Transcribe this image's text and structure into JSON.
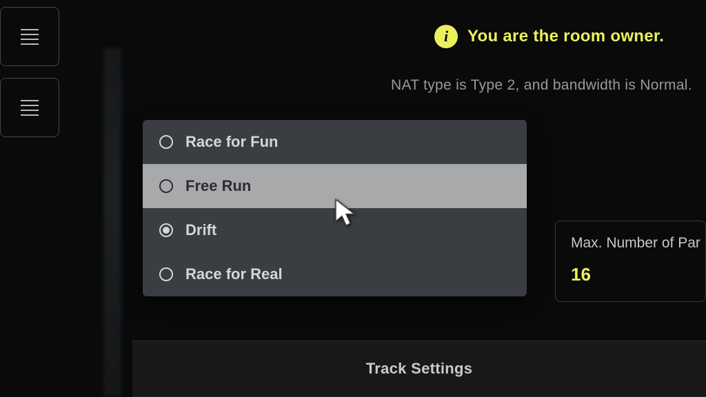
{
  "owner_message": "You are the room owner.",
  "nat_status": "NAT type is Type 2, and bandwidth is Normal.",
  "mode_menu": {
    "selected": "Drift",
    "highlighted": "Free Run",
    "options": [
      {
        "label": "Race for Fun"
      },
      {
        "label": "Free Run"
      },
      {
        "label": "Drift"
      },
      {
        "label": "Race for Real"
      }
    ]
  },
  "max_participants": {
    "label": "Max. Number of Par",
    "value": "16"
  },
  "bottom_section_title": "Track Settings",
  "info_glyph": "i"
}
